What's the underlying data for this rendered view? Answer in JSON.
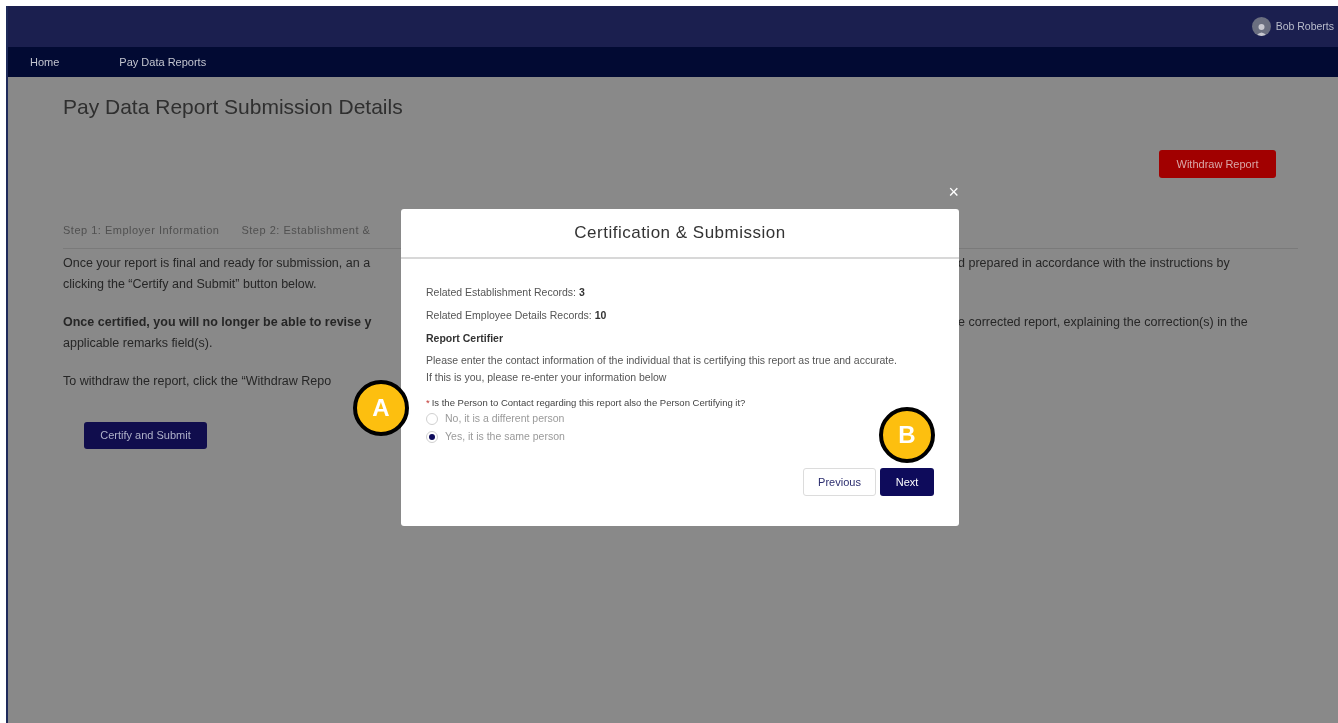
{
  "user": {
    "name": "Bob Roberts"
  },
  "nav": [
    {
      "label": "Home"
    },
    {
      "label": "Pay Data Reports"
    }
  ],
  "page_title": "Pay Data Report Submission Details",
  "withdraw_button": "Withdraw Report",
  "steps": [
    "Step 1: Employer Information",
    "Step 2: Establishment &"
  ],
  "paragraphs": [
    {
      "lines": [
        {
          "left": "Once your report is final and ready for submission, an a",
          "right": "d prepared in accordance with the instructions by",
          "bold": false
        },
        {
          "left": "clicking the “Certify and Submit” button below.",
          "bold": false
        }
      ]
    },
    {
      "lines": [
        {
          "left": "Once certified, you will no longer be able to revise y",
          "right": "e corrected report, explaining the correction(s) in the",
          "bold": true
        },
        {
          "left": "applicable remarks field(s).",
          "bold": false
        }
      ]
    },
    {
      "lines": [
        {
          "left": "To withdraw the report, click the “Withdraw Repo",
          "bold": false
        }
      ]
    }
  ],
  "certify_button": "Certify and Submit",
  "modal": {
    "title": "Certification & Submission",
    "close": "×",
    "records": [
      {
        "label": "Related Establishment Records:",
        "value": "3"
      },
      {
        "label": "Related Employee Details Records:",
        "value": "10"
      }
    ],
    "section_title": "Report Certifier",
    "instructions": [
      "Please enter the contact information of the individual that is certifying this report as true and accurate.",
      "If this is you, please re-enter your information below"
    ],
    "question": {
      "required_mark": "*",
      "label": "Is the Person to Contact regarding this report also the Person Certifying it?"
    },
    "options": [
      {
        "label": "No, it is a different person",
        "selected": false
      },
      {
        "label": "Yes, it is the same person",
        "selected": true
      }
    ],
    "buttons": [
      {
        "label": "Previous",
        "kind": "secondary"
      },
      {
        "label": "Next",
        "kind": "primary"
      }
    ]
  },
  "callouts": [
    {
      "label": "A"
    },
    {
      "label": "B"
    }
  ]
}
